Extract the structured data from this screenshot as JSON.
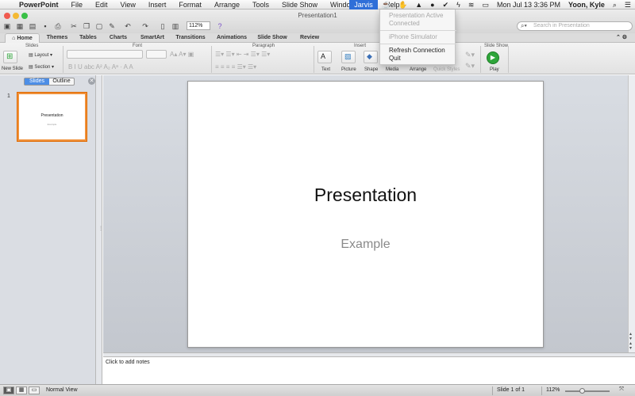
{
  "menubar": {
    "app": "PowerPoint",
    "items": [
      "File",
      "Edit",
      "View",
      "Insert",
      "Format",
      "Arrange",
      "Tools",
      "Slide Show",
      "Window",
      "Help"
    ],
    "jarvis": "Jarvis",
    "clock": "Mon Jul 13  3:36 PM",
    "user": "Yoon, Kyle"
  },
  "window": {
    "title": "Presentation1"
  },
  "toolbar": {
    "zoom_value": "112%",
    "search_placeholder": "Search in Presentation"
  },
  "ribbon": {
    "tabs": [
      "Home",
      "Themes",
      "Tables",
      "Charts",
      "SmartArt",
      "Transitions",
      "Animations",
      "Slide Show",
      "Review"
    ],
    "active_tab": "Home",
    "groups": {
      "slides": "Slides",
      "font": "Font",
      "paragraph": "Paragraph",
      "insert": "Insert",
      "format": "Format",
      "slide_show": "Slide Show"
    },
    "buttons": {
      "new_slide": "New Slide",
      "layout": "Layout",
      "section": "Section",
      "text": "Text",
      "picture": "Picture",
      "shape": "Shape",
      "media": "Media",
      "arrange": "Arrange",
      "quick_styles": "Quick Styles",
      "play": "Play"
    }
  },
  "dropdown": {
    "status_line1": "Presentation Active",
    "status_line2": "Connected",
    "iphone": "iPhone Simulator",
    "refresh": "Refresh Connection",
    "quit": "Quit"
  },
  "left_panel": {
    "tab_slides": "Slides",
    "tab_outline": "Outline",
    "thumb_number": "1",
    "thumb_title": "Presentation",
    "thumb_subtitle": "Example"
  },
  "slide": {
    "title": "Presentation",
    "subtitle": "Example"
  },
  "notes": {
    "placeholder": "Click to add notes"
  },
  "status": {
    "view": "Normal View",
    "slide": "Slide 1 of 1",
    "zoom": "112%"
  },
  "colors": {
    "accent_selection": "#2f6fd8",
    "thumb_border": "#f0913a",
    "play_green": "#2ea53a"
  }
}
